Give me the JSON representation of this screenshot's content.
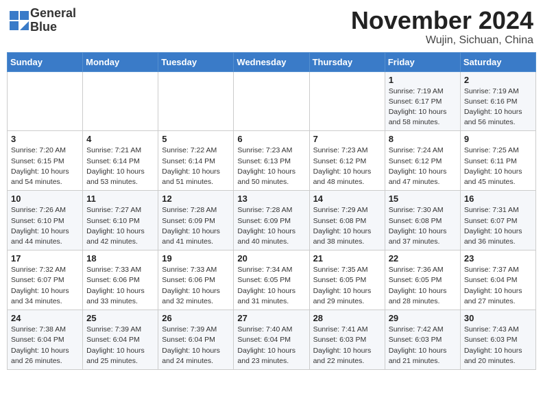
{
  "header": {
    "logo_line1": "General",
    "logo_line2": "Blue",
    "month": "November 2024",
    "location": "Wujin, Sichuan, China"
  },
  "weekdays": [
    "Sunday",
    "Monday",
    "Tuesday",
    "Wednesday",
    "Thursday",
    "Friday",
    "Saturday"
  ],
  "weeks": [
    [
      {
        "day": "",
        "info": ""
      },
      {
        "day": "",
        "info": ""
      },
      {
        "day": "",
        "info": ""
      },
      {
        "day": "",
        "info": ""
      },
      {
        "day": "",
        "info": ""
      },
      {
        "day": "1",
        "info": "Sunrise: 7:19 AM\nSunset: 6:17 PM\nDaylight: 10 hours\nand 58 minutes."
      },
      {
        "day": "2",
        "info": "Sunrise: 7:19 AM\nSunset: 6:16 PM\nDaylight: 10 hours\nand 56 minutes."
      }
    ],
    [
      {
        "day": "3",
        "info": "Sunrise: 7:20 AM\nSunset: 6:15 PM\nDaylight: 10 hours\nand 54 minutes."
      },
      {
        "day": "4",
        "info": "Sunrise: 7:21 AM\nSunset: 6:14 PM\nDaylight: 10 hours\nand 53 minutes."
      },
      {
        "day": "5",
        "info": "Sunrise: 7:22 AM\nSunset: 6:14 PM\nDaylight: 10 hours\nand 51 minutes."
      },
      {
        "day": "6",
        "info": "Sunrise: 7:23 AM\nSunset: 6:13 PM\nDaylight: 10 hours\nand 50 minutes."
      },
      {
        "day": "7",
        "info": "Sunrise: 7:23 AM\nSunset: 6:12 PM\nDaylight: 10 hours\nand 48 minutes."
      },
      {
        "day": "8",
        "info": "Sunrise: 7:24 AM\nSunset: 6:12 PM\nDaylight: 10 hours\nand 47 minutes."
      },
      {
        "day": "9",
        "info": "Sunrise: 7:25 AM\nSunset: 6:11 PM\nDaylight: 10 hours\nand 45 minutes."
      }
    ],
    [
      {
        "day": "10",
        "info": "Sunrise: 7:26 AM\nSunset: 6:10 PM\nDaylight: 10 hours\nand 44 minutes."
      },
      {
        "day": "11",
        "info": "Sunrise: 7:27 AM\nSunset: 6:10 PM\nDaylight: 10 hours\nand 42 minutes."
      },
      {
        "day": "12",
        "info": "Sunrise: 7:28 AM\nSunset: 6:09 PM\nDaylight: 10 hours\nand 41 minutes."
      },
      {
        "day": "13",
        "info": "Sunrise: 7:28 AM\nSunset: 6:09 PM\nDaylight: 10 hours\nand 40 minutes."
      },
      {
        "day": "14",
        "info": "Sunrise: 7:29 AM\nSunset: 6:08 PM\nDaylight: 10 hours\nand 38 minutes."
      },
      {
        "day": "15",
        "info": "Sunrise: 7:30 AM\nSunset: 6:08 PM\nDaylight: 10 hours\nand 37 minutes."
      },
      {
        "day": "16",
        "info": "Sunrise: 7:31 AM\nSunset: 6:07 PM\nDaylight: 10 hours\nand 36 minutes."
      }
    ],
    [
      {
        "day": "17",
        "info": "Sunrise: 7:32 AM\nSunset: 6:07 PM\nDaylight: 10 hours\nand 34 minutes."
      },
      {
        "day": "18",
        "info": "Sunrise: 7:33 AM\nSunset: 6:06 PM\nDaylight: 10 hours\nand 33 minutes."
      },
      {
        "day": "19",
        "info": "Sunrise: 7:33 AM\nSunset: 6:06 PM\nDaylight: 10 hours\nand 32 minutes."
      },
      {
        "day": "20",
        "info": "Sunrise: 7:34 AM\nSunset: 6:05 PM\nDaylight: 10 hours\nand 31 minutes."
      },
      {
        "day": "21",
        "info": "Sunrise: 7:35 AM\nSunset: 6:05 PM\nDaylight: 10 hours\nand 29 minutes."
      },
      {
        "day": "22",
        "info": "Sunrise: 7:36 AM\nSunset: 6:05 PM\nDaylight: 10 hours\nand 28 minutes."
      },
      {
        "day": "23",
        "info": "Sunrise: 7:37 AM\nSunset: 6:04 PM\nDaylight: 10 hours\nand 27 minutes."
      }
    ],
    [
      {
        "day": "24",
        "info": "Sunrise: 7:38 AM\nSunset: 6:04 PM\nDaylight: 10 hours\nand 26 minutes."
      },
      {
        "day": "25",
        "info": "Sunrise: 7:39 AM\nSunset: 6:04 PM\nDaylight: 10 hours\nand 25 minutes."
      },
      {
        "day": "26",
        "info": "Sunrise: 7:39 AM\nSunset: 6:04 PM\nDaylight: 10 hours\nand 24 minutes."
      },
      {
        "day": "27",
        "info": "Sunrise: 7:40 AM\nSunset: 6:04 PM\nDaylight: 10 hours\nand 23 minutes."
      },
      {
        "day": "28",
        "info": "Sunrise: 7:41 AM\nSunset: 6:03 PM\nDaylight: 10 hours\nand 22 minutes."
      },
      {
        "day": "29",
        "info": "Sunrise: 7:42 AM\nSunset: 6:03 PM\nDaylight: 10 hours\nand 21 minutes."
      },
      {
        "day": "30",
        "info": "Sunrise: 7:43 AM\nSunset: 6:03 PM\nDaylight: 10 hours\nand 20 minutes."
      }
    ]
  ]
}
